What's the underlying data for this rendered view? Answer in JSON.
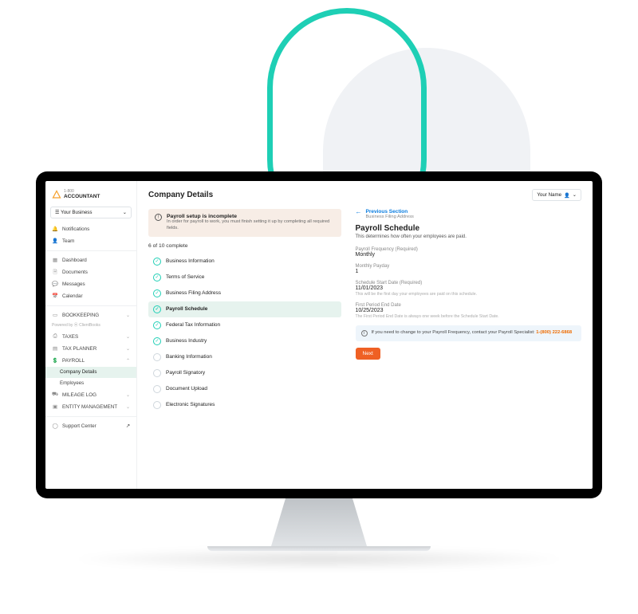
{
  "brand": {
    "top": "1-800",
    "main": "ACCOUNTANT"
  },
  "business_selector": "Your Business",
  "nav": {
    "notifications": "Notifications",
    "team": "Team",
    "dashboard": "Dashboard",
    "documents": "Documents",
    "messages": "Messages",
    "calendar": "Calendar",
    "bookkeeping": "BOOKKEEPING",
    "powered_by": "Powered by ⦿ ClientBooks",
    "taxes": "TAXES",
    "tax_planner": "TAX PLANNER",
    "payroll": "PAYROLL",
    "company_details": "Company Details",
    "employees": "Employees",
    "mileage_log": "MILEAGE LOG",
    "entity_mgmt": "ENTITY MANAGEMENT",
    "support": "Support Center"
  },
  "page_title": "Company Details",
  "user_name": "Your Name",
  "alert": {
    "title": "Payroll setup is incomplete",
    "sub": "In order for payroll to work, you must finish setting it up by completing all required fields."
  },
  "progress": "6 of 10 complete",
  "checklist": [
    {
      "label": "Business Information",
      "done": true
    },
    {
      "label": "Terms of Service",
      "done": true
    },
    {
      "label": "Business Filing Address",
      "done": true
    },
    {
      "label": "Payroll Schedule",
      "done": true,
      "active": true
    },
    {
      "label": "Federal Tax Information",
      "done": true
    },
    {
      "label": "Business Industry",
      "done": true
    },
    {
      "label": "Banking Information",
      "done": false
    },
    {
      "label": "Payroll Signatory",
      "done": false
    },
    {
      "label": "Document Upload",
      "done": false
    },
    {
      "label": "Electronic Signatures",
      "done": false
    }
  ],
  "prev_section": {
    "title": "Previous Section",
    "sub": "Business Filing Address"
  },
  "section": {
    "title": "Payroll Schedule",
    "sub": "This determines how often your employees are paid."
  },
  "fields": {
    "frequency_label": "Payroll Frequency (Required)",
    "frequency_value": "Monthly",
    "payday_label": "Monthly Payday",
    "payday_value": "1",
    "start_label": "Schedule Start Date (Required)",
    "start_value": "11/01/2023",
    "start_help": "This will be the first day your employees are paid on this schedule.",
    "end_label": "First Period End Date",
    "end_value": "10/25/2023",
    "end_help": "The First Period End Date is always one week before the Schedule Start Date."
  },
  "info": {
    "pre": "If you need to change to your Payroll Frequency, contact your Payroll Specialist: ",
    "phone": "1-(800) 222-6868"
  },
  "next_label": "Next"
}
